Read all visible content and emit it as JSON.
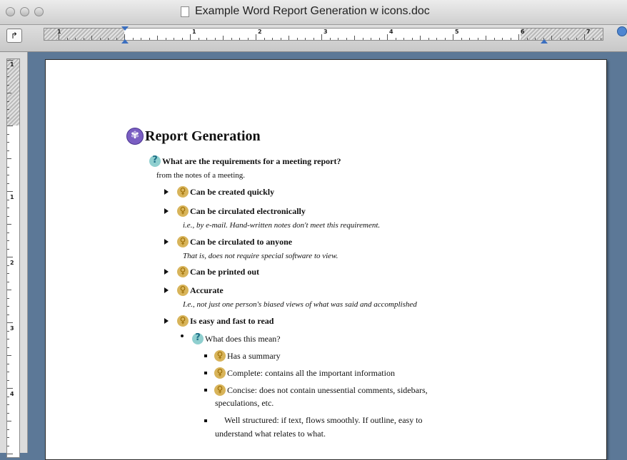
{
  "window": {
    "title": "Example Word Report Generation w icons.doc"
  },
  "ruler": {
    "tab_selector_glyph": "↱",
    "h_numbers": [
      "1",
      "1",
      "2",
      "3",
      "4",
      "5",
      "6",
      "7"
    ],
    "v_numbers": [
      "1",
      "1",
      "2",
      "3",
      "4"
    ]
  },
  "document": {
    "heading": "Report Generation",
    "question": "What are the requirements for a meeting report?",
    "question_note": "from the notes of a meeting.",
    "items": [
      {
        "label": "Can be created quickly",
        "note": ""
      },
      {
        "label": "Can be circulated electronically",
        "note": "i.e., by e-mail. Hand-written notes don't meet this requirement."
      },
      {
        "label": "Can be circulated to anyone",
        "note": "That is, does not require special software to view."
      },
      {
        "label": "Can be printed out",
        "note": ""
      },
      {
        "label": "Accurate",
        "note": "I.e., not just one person's biased views of what was said and accomplished"
      },
      {
        "label": "Is easy and fast to read",
        "note": ""
      }
    ],
    "subquestion": "What does this mean?",
    "subitems": [
      "Has a summary",
      "Complete: contains all the important information",
      "Concise: does not contain unessential comments, sidebars,",
      "speculations, etc."
    ],
    "last_item_line1": "Well structured: if text, flows smoothly. If outline, easy to",
    "last_item_line2": "understand what relates to what."
  }
}
